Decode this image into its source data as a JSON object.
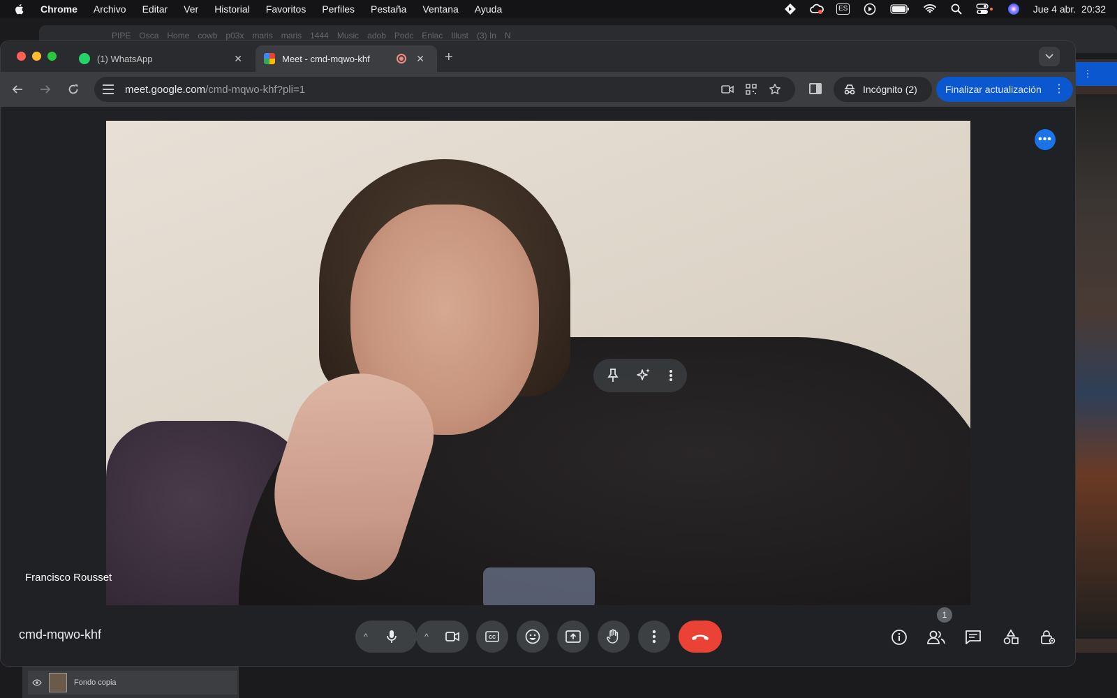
{
  "menubar": {
    "app_name": "Chrome",
    "menus": [
      "Archivo",
      "Editar",
      "Ver",
      "Historial",
      "Favoritos",
      "Perfiles",
      "Pestaña",
      "Ventana",
      "Ayuda"
    ],
    "input_source": "ES",
    "datetime": "Jue 4 abr.  20:32"
  },
  "background_window": {
    "tabs": [
      "PIPE",
      "Osca",
      "Home",
      "cowb",
      "p03x",
      "maris",
      "maris",
      "1444",
      "Music",
      "adob",
      "Podc",
      "Enlac",
      "Illust",
      "(3) In",
      "N"
    ],
    "right_button_fragment": "ón",
    "layers_panel_item": "Fondo copia"
  },
  "chrome": {
    "tabs": [
      {
        "title": "(1) WhatsApp"
      },
      {
        "title": "Meet - cmd-mqwo-khf"
      }
    ],
    "url_host": "meet.google.com",
    "url_path": "/cmd-mqwo-khf?pli=1",
    "incognito_label": "Incógnito (2)",
    "update_label": "Finalizar actualización"
  },
  "meet": {
    "participant_name": "Francisco Rousset",
    "meeting_code": "cmd-mqwo-khf",
    "people_count": "1"
  },
  "colors": {
    "hangup": "#ea4335",
    "accent": "#0b57d0",
    "more_bubble": "#1a73e8"
  }
}
